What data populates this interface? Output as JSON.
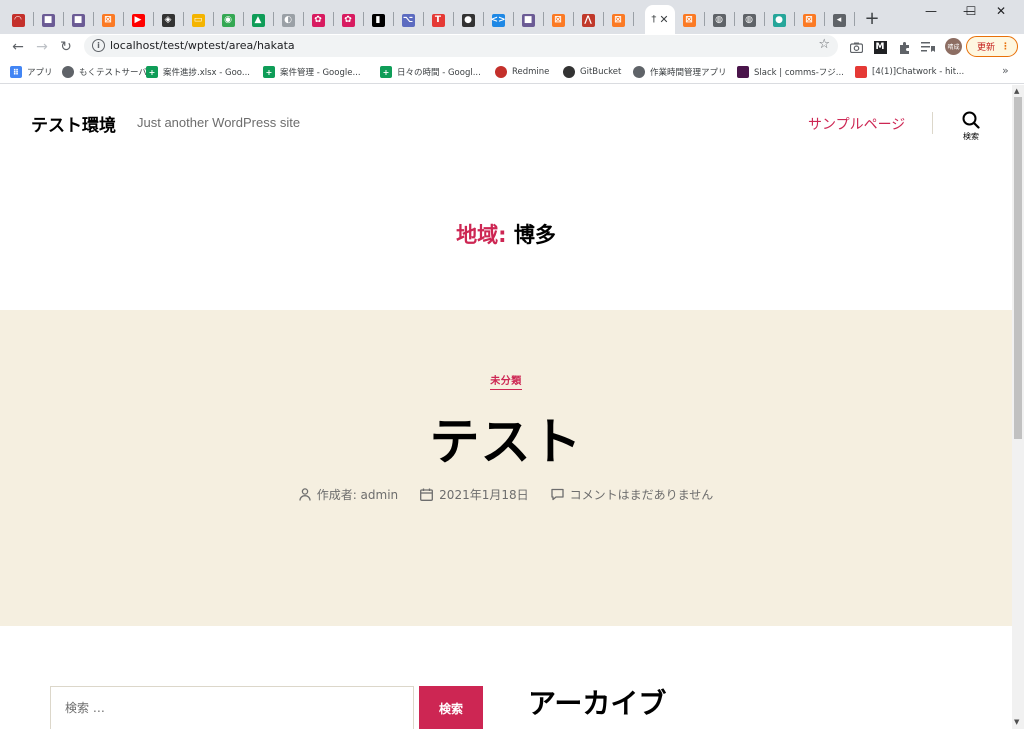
{
  "browser": {
    "active_tab_label": "†",
    "url": "localhost/test/wptest/area/hakata",
    "update_button": "更新",
    "tabs": [
      {
        "icon": "redmine-icon",
        "color": "#c4302b",
        "glyph": "◠"
      },
      {
        "icon": "box-icon",
        "color": "#6b5b95",
        "glyph": "■"
      },
      {
        "icon": "box-icon",
        "color": "#6b5b95",
        "glyph": "■"
      },
      {
        "icon": "xampp-icon",
        "color": "#fb7a24",
        "glyph": "⊠"
      },
      {
        "icon": "youtube-icon",
        "color": "#ff0000",
        "glyph": "▶"
      },
      {
        "icon": "gitbucket-icon",
        "color": "#333333",
        "glyph": "◈"
      },
      {
        "icon": "slides-icon",
        "color": "#f4b400",
        "glyph": "▭"
      },
      {
        "icon": "green-circle-icon",
        "color": "#34a853",
        "glyph": "◉"
      },
      {
        "icon": "drive-icon",
        "color": "#0f9d58",
        "glyph": "▲"
      },
      {
        "icon": "grey-icon",
        "color": "#9aa0a6",
        "glyph": "◐"
      },
      {
        "icon": "bug-icon",
        "color": "#d81b60",
        "glyph": "✿"
      },
      {
        "icon": "bug-icon",
        "color": "#d81b60",
        "glyph": "✿"
      },
      {
        "icon": "black-square-icon",
        "color": "#000000",
        "glyph": "▮"
      },
      {
        "icon": "fork-icon",
        "color": "#5c6bc0",
        "glyph": "⌥"
      },
      {
        "icon": "t-icon",
        "color": "#e53935",
        "glyph": "T"
      },
      {
        "icon": "github-icon",
        "color": "#333333",
        "glyph": "●"
      },
      {
        "icon": "code-icon",
        "color": "#1e88e5",
        "glyph": "<>"
      },
      {
        "icon": "box-icon",
        "color": "#6b5b95",
        "glyph": "■"
      },
      {
        "icon": "xampp-icon",
        "color": "#fb7a24",
        "glyph": "⊠"
      },
      {
        "icon": "jmeter-icon",
        "color": "#c0392b",
        "glyph": "⋀"
      },
      {
        "icon": "xampp-icon",
        "color": "#fb7a24",
        "glyph": "⊠"
      }
    ],
    "tabs_after": [
      {
        "icon": "xampp-icon",
        "color": "#fb7a24",
        "glyph": "⊠"
      },
      {
        "icon": "globe-icon",
        "color": "#5f6368",
        "glyph": "◍"
      },
      {
        "icon": "globe-icon",
        "color": "#5f6368",
        "glyph": "◍"
      },
      {
        "icon": "flag-icon",
        "color": "#26a69a",
        "glyph": "●"
      },
      {
        "icon": "xampp-icon",
        "color": "#fb7a24",
        "glyph": "⊠"
      },
      {
        "icon": "audio-icon",
        "color": "#5f6368",
        "glyph": "◂"
      }
    ],
    "bookmarks": [
      {
        "icon": "apps-icon",
        "label": "アプリ",
        "color": "#4285f4"
      },
      {
        "icon": "globe-icon",
        "label": "もくテストサーバ",
        "color": "#5f6368"
      },
      {
        "icon": "sheets-icon",
        "label": "案件進捗.xlsx - Goo...",
        "color": "#0f9d58"
      },
      {
        "icon": "sheets-icon",
        "label": "案件管理 - Google...",
        "color": "#0f9d58"
      },
      {
        "icon": "sheets-icon",
        "label": "日々の時間 - Googl...",
        "color": "#0f9d58"
      },
      {
        "icon": "redmine-icon",
        "label": "Redmine",
        "color": "#c4302b"
      },
      {
        "icon": "gitbucket-icon",
        "label": "GitBucket",
        "color": "#333333"
      },
      {
        "icon": "globe-icon",
        "label": "作業時間管理アプリ",
        "color": "#5f6368"
      },
      {
        "icon": "slack-icon",
        "label": "Slack | comms-フジ...",
        "color": "#4a154b"
      },
      {
        "icon": "chatwork-icon",
        "label": "[4(1)]Chatwork - hit...",
        "color": "#e53935"
      }
    ]
  },
  "site": {
    "title": "テスト環境",
    "description": "Just another WordPress site",
    "nav_link": "サンプルページ",
    "search_toggle_label": "検索"
  },
  "archive": {
    "prefix": "地域:",
    "term": "博多"
  },
  "post": {
    "category": "未分類",
    "title": "テスト",
    "author": "作成者: admin",
    "date": "2021年1月18日",
    "comments": "コメントはまだありません"
  },
  "widgets": {
    "search_placeholder": "検索 …",
    "search_button": "検索",
    "archive_title": "アーカイブ"
  }
}
